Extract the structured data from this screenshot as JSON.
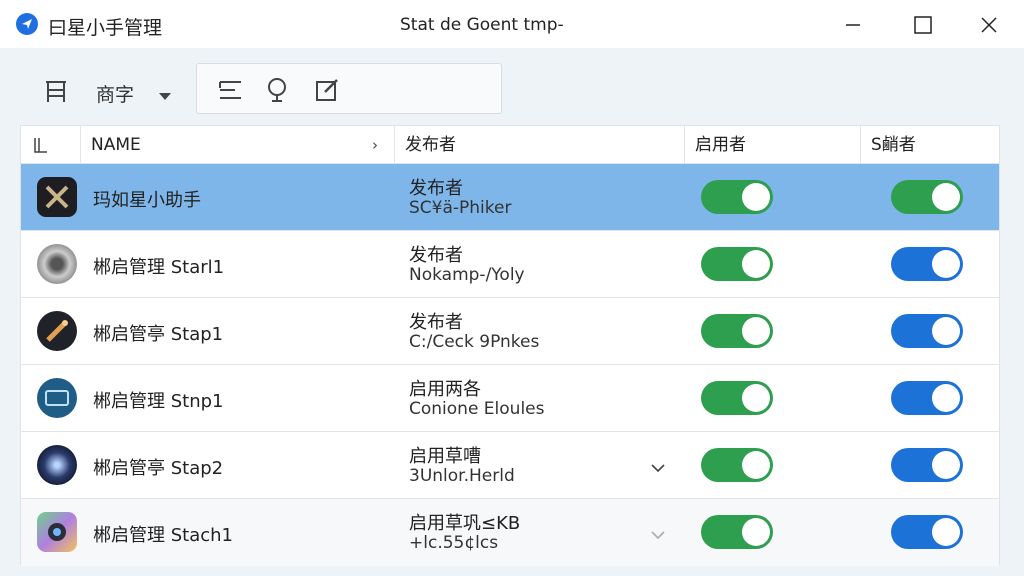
{
  "app": {
    "title": "曰星小手管理",
    "window_title": "Stat de Goent tmp-"
  },
  "toolbar": {
    "dropdown_label": "商字"
  },
  "table": {
    "headers": {
      "name": "NAME",
      "publisher": "发布者",
      "enabled": "启用者",
      "status": "S䴛者"
    },
    "rows": [
      {
        "name": "玛如星小助手",
        "pub_line1": "发布者",
        "pub_line2": "SC¥ä-Phiker",
        "toggle1": "on",
        "toggle2": "on",
        "toggle2_color": "green"
      },
      {
        "name": "郴启管理 Starl1",
        "pub_line1": "发布者",
        "pub_line2": "Nokamp-/Yoly",
        "toggle1": "on",
        "toggle2": "on",
        "toggle2_color": "blue"
      },
      {
        "name": "郴启管亭 Stap1",
        "pub_line1": "发布者",
        "pub_line2": "C:/Ceck 9Pnkes",
        "toggle1": "on",
        "toggle2": "on",
        "toggle2_color": "blue"
      },
      {
        "name": "郴启管理 Stnp1",
        "pub_line1": "启用两各",
        "pub_line2": "Conione Eloules",
        "toggle1": "on",
        "toggle2": "on",
        "toggle2_color": "blue"
      },
      {
        "name": "郴启管亭 Stap2",
        "pub_line1": "启用草嘈",
        "pub_line2": "3Unlor.Herld",
        "toggle1": "on",
        "toggle2": "on",
        "toggle2_color": "blue"
      },
      {
        "name": "郴启管理 Stach1",
        "pub_line1": "启用草巩≤KB",
        "pub_line2": "+lc.55¢lcs",
        "toggle1": "on",
        "toggle2": "on",
        "toggle2_color": "blue"
      }
    ]
  },
  "colors": {
    "accent": "#1d72d8",
    "toggle_green": "#2e9e4f",
    "selected_row": "#7fb6ea"
  },
  "icons": [
    "app-logo-icon",
    "minimize-icon",
    "maximize-icon",
    "close-icon",
    "table-view-icon",
    "dropdown-caret-icon",
    "list-icon",
    "pin-icon",
    "edit-icon"
  ]
}
